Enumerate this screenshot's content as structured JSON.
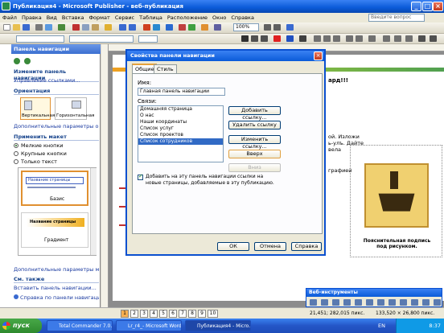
{
  "window": {
    "title": "Публикация4 - Microsoft Publisher - веб-публикация"
  },
  "menu": [
    "Файл",
    "Правка",
    "Вид",
    "Вставка",
    "Формат",
    "Сервис",
    "Таблица",
    "Расположение",
    "Окно",
    "Справка"
  ],
  "help_placeholder": "Введите вопрос",
  "zoom": "100%",
  "pane": {
    "title": "Панель навигации",
    "heading": "Измените панель навигации",
    "manage_link": "Управление ссылками...",
    "orientation_head": "Ориентация",
    "vertical": "Вертикальная",
    "horizontal": "Горизонтальная",
    "more_orient": "Дополнительные параметры ориент",
    "apply_head": "Применить макет",
    "radio_small": "Мелкие кнопки",
    "radio_large": "Крупные кнопки",
    "radio_text": "Только текст",
    "sample1_title": "Название страницы",
    "sample1_label": "Базис",
    "sample2_title": "Название страницы",
    "sample2_label": "Градиент",
    "more_layout": "Дополнительные параметры макета",
    "see_also": "См. также",
    "insert_link": "Вставить панель навигации...",
    "help_link": "Справка по панели навигации"
  },
  "doc": {
    "text_frag1": "ард!!!",
    "text_frag2": "ой. Изложи",
    "text_frag3": "ь-улъ. Дайте",
    "text_frag4": "вела",
    "text_frag5": "графией",
    "caption": "Пояснительная подпись под рисунком.",
    "ruler_marker": "0"
  },
  "dialog": {
    "title": "Свойства панели навигации",
    "tab_general": "Общие",
    "tab_style": "Стиль",
    "name_label": "Имя:",
    "name_value": "Главная панель навигации",
    "links_label": "Связи:",
    "links": [
      "Домашняя страница",
      "О нас",
      "Наши координаты",
      "Список услуг",
      "Список проектов",
      "Список сотрудников"
    ],
    "selected_index": 5,
    "btn_add": "Добавить ссылку...",
    "btn_remove": "Удалить ссылку",
    "btn_change": "Изменить ссылку...",
    "btn_up": "Вверх",
    "btn_down": "Вниз",
    "checkbox_text": "Добавить на эту панель навигации ссылки на новые страницы, добавляемые в эту публикацию.",
    "ok": "ОК",
    "cancel": "Отмена",
    "help": "Справка"
  },
  "webtools": {
    "title": "Веб-инструменты"
  },
  "status": {
    "pages": [
      "1",
      "2",
      "3",
      "4",
      "5",
      "6",
      "7",
      "8",
      "9",
      "10"
    ],
    "current_page": "1",
    "pos": "21,451; 282,015 пикс.",
    "size": "133,520 × 26,800 пикс."
  },
  "taskbar": {
    "start": "пуск",
    "tasks": [
      "Total Commander 7.0...",
      "Lr_r4_- Microsoft Word",
      "Публикация4 - Micro..."
    ],
    "lang": "EN",
    "time": "8:37"
  },
  "colors": {
    "accent": "#0a5ad8",
    "start": "#3c9a3c",
    "selection": "#316ac5"
  }
}
